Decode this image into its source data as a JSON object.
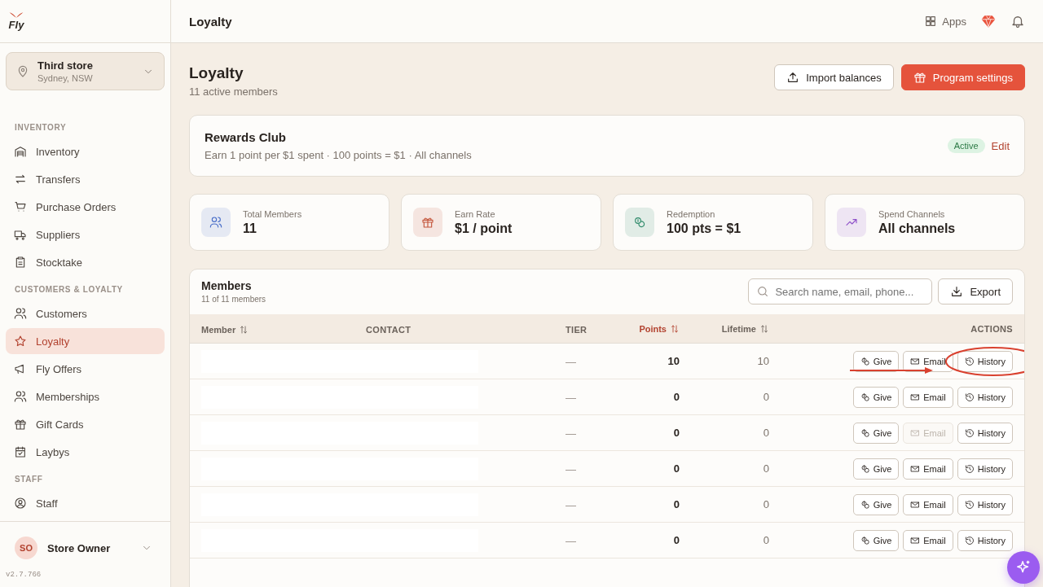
{
  "logo": {
    "text": "Fly"
  },
  "store": {
    "name": "Third store",
    "location": "Sydney, NSW"
  },
  "sidebar": {
    "sections": [
      {
        "heading": "INVENTORY",
        "items": [
          {
            "label": "Inventory",
            "selected": false
          },
          {
            "label": "Transfers",
            "selected": false
          },
          {
            "label": "Purchase Orders",
            "selected": false
          },
          {
            "label": "Suppliers",
            "selected": false
          },
          {
            "label": "Stocktake",
            "selected": false
          }
        ]
      },
      {
        "heading": "CUSTOMERS & LOYALTY",
        "items": [
          {
            "label": "Customers",
            "selected": false
          },
          {
            "label": "Loyalty",
            "selected": true
          },
          {
            "label": "Fly Offers",
            "selected": false
          },
          {
            "label": "Memberships",
            "selected": false
          },
          {
            "label": "Gift Cards",
            "selected": false
          },
          {
            "label": "Laybys",
            "selected": false
          }
        ]
      },
      {
        "heading": "STAFF",
        "items": [
          {
            "label": "Staff",
            "selected": false
          }
        ]
      }
    ]
  },
  "user": {
    "initials": "SO",
    "name": "Store Owner"
  },
  "version": "v2.7.766",
  "topbar": {
    "title": "Loyalty",
    "apps": "Apps"
  },
  "page": {
    "title": "Loyalty",
    "subtitle": "11 active members",
    "buttons": [
      {
        "label": "Import balances",
        "kind": "secondary"
      },
      {
        "label": "Program settings",
        "kind": "primary"
      }
    ]
  },
  "program": {
    "name": "Rewards Club",
    "description": "Earn 1 point per $1 spent · 100 points = $1 · All channels",
    "status": "Active",
    "edit": "Edit"
  },
  "stats": [
    {
      "label": "Total Members",
      "value": "11",
      "color": "#4a6fc9"
    },
    {
      "label": "Earn Rate",
      "value": "$1 / point",
      "color": "#c4553b"
    },
    {
      "label": "Redemption",
      "value": "100 pts = $1",
      "color": "#2f8a6a"
    },
    {
      "label": "Spend Channels",
      "value": "All channels",
      "color": "#8e4fc9"
    }
  ],
  "members": {
    "title": "Members",
    "count": "11 of 11 members",
    "search": {
      "placeholder": "Search name, email, phone..."
    },
    "export": "Export",
    "columns": [
      {
        "label": "Member",
        "sortable": true,
        "active": false
      },
      {
        "label": "CONTACT",
        "sortable": false,
        "active": false
      },
      {
        "label": "TIER",
        "sortable": false,
        "active": false
      },
      {
        "label": "Points",
        "sortable": true,
        "active": true
      },
      {
        "label": "Lifetime",
        "sortable": true,
        "active": false
      },
      {
        "label": "ACTIONS",
        "sortable": false,
        "active": false
      }
    ],
    "rows": [
      {
        "tier": "—",
        "points": "10",
        "lifetime": "10",
        "actions": [
          {
            "label": "Give",
            "kind": "give",
            "disabled": false
          },
          {
            "label": "Email",
            "kind": "email",
            "disabled": false
          },
          {
            "label": "History",
            "kind": "history",
            "disabled": false
          }
        ]
      },
      {
        "tier": "—",
        "points": "0",
        "lifetime": "0",
        "actions": [
          {
            "label": "Give",
            "kind": "give",
            "disabled": false
          },
          {
            "label": "Email",
            "kind": "email",
            "disabled": false
          },
          {
            "label": "History",
            "kind": "history",
            "disabled": false
          }
        ]
      },
      {
        "tier": "—",
        "points": "0",
        "lifetime": "0",
        "actions": [
          {
            "label": "Give",
            "kind": "give",
            "disabled": false
          },
          {
            "label": "Email",
            "kind": "email",
            "disabled": true
          },
          {
            "label": "History",
            "kind": "history",
            "disabled": false
          }
        ]
      },
      {
        "tier": "—",
        "points": "0",
        "lifetime": "0",
        "actions": [
          {
            "label": "Give",
            "kind": "give",
            "disabled": false
          },
          {
            "label": "Email",
            "kind": "email",
            "disabled": false
          },
          {
            "label": "History",
            "kind": "history",
            "disabled": false
          }
        ]
      },
      {
        "tier": "—",
        "points": "0",
        "lifetime": "0",
        "actions": [
          {
            "label": "Give",
            "kind": "give",
            "disabled": false
          },
          {
            "label": "Email",
            "kind": "email",
            "disabled": false
          },
          {
            "label": "History",
            "kind": "history",
            "disabled": false
          }
        ]
      },
      {
        "tier": "—",
        "points": "0",
        "lifetime": "0",
        "actions": [
          {
            "label": "Give",
            "kind": "give",
            "disabled": false
          },
          {
            "label": "Email",
            "kind": "email",
            "disabled": false
          },
          {
            "label": "History",
            "kind": "history",
            "disabled": false
          }
        ]
      }
    ]
  }
}
